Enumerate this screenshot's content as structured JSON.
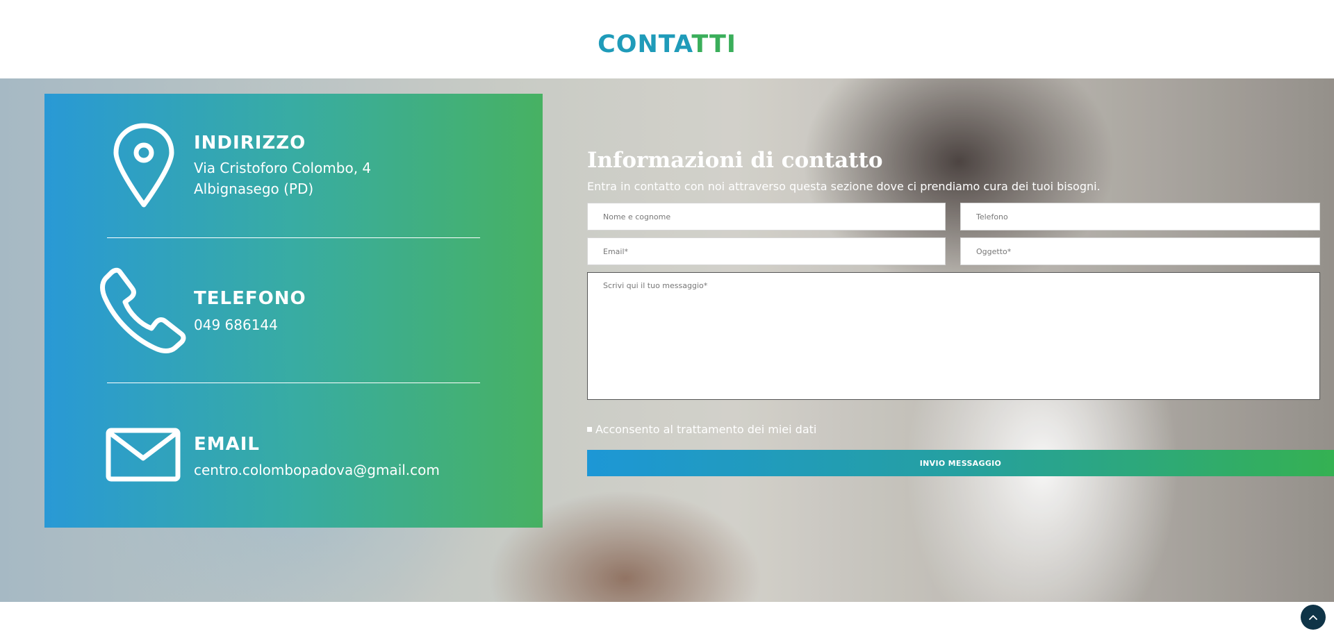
{
  "header": {
    "title_part1": "CONTA",
    "title_part2": "TTI"
  },
  "contact_info": {
    "address": {
      "icon": "location-pin-icon",
      "heading": "INDIRIZZO",
      "line1": "Via Cristoforo Colombo, 4",
      "line2": "Albignasego (PD)"
    },
    "phone": {
      "icon": "phone-icon",
      "heading": "TELEFONO",
      "value": "049 686144"
    },
    "email": {
      "icon": "mail-icon",
      "heading": "EMAIL",
      "value": "centro.colombopadova@gmail.com"
    }
  },
  "form": {
    "title": "Informazioni di contatto",
    "subtitle": "Entra in contatto con noi attraverso questa sezione dove ci prendiamo cura dei tuoi bisogni.",
    "name_placeholder": "Nome e cognome",
    "phone_placeholder": "Telefono",
    "email_placeholder": "Email*",
    "subject_placeholder": "Oggetto*",
    "message_placeholder": "Scrivi qui il tuo messaggio*",
    "consent_label": "Acconsento al trattamento dei miei dati",
    "submit_label": "INVIO MESSAGGIO"
  },
  "colors": {
    "brand_blue": "#1f9bb9",
    "brand_green": "#3aae5a",
    "back_to_top_bg": "#0f3447"
  },
  "back_to_top": {
    "icon": "chevron-up-icon"
  }
}
